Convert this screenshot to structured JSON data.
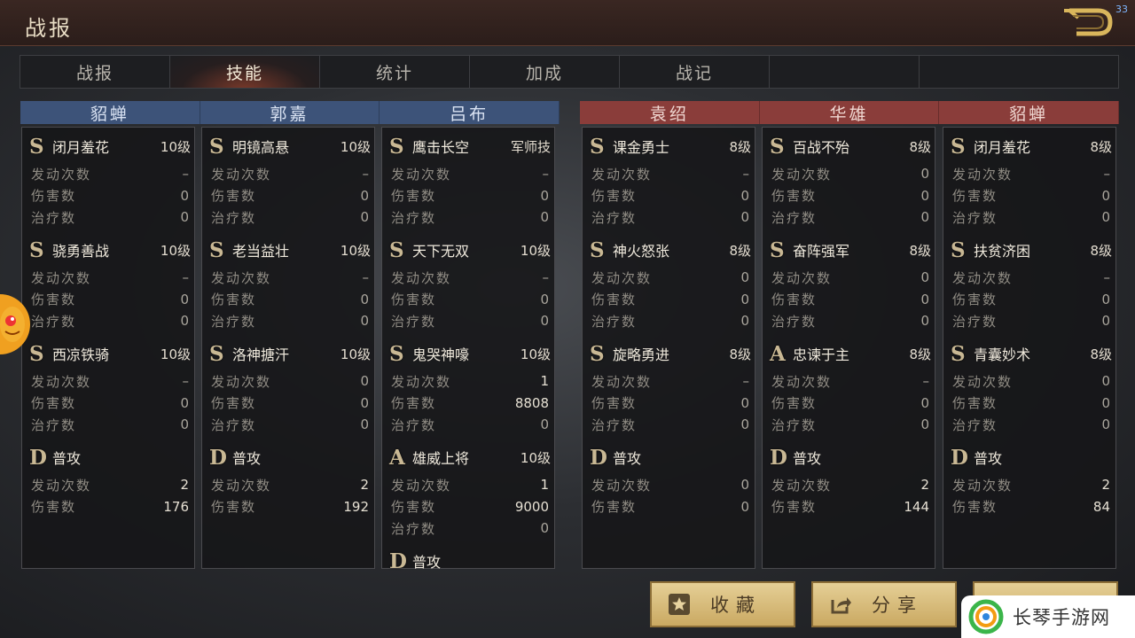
{
  "header": {
    "title": "战报",
    "corner_number": "33"
  },
  "tabs": [
    {
      "label": "战报",
      "active": false
    },
    {
      "label": "技能",
      "active": true
    },
    {
      "label": "统计",
      "active": false
    },
    {
      "label": "加成",
      "active": false
    },
    {
      "label": "战记",
      "active": false
    },
    {
      "label": "",
      "active": false
    },
    {
      "label": "",
      "active": false
    }
  ],
  "colors": {
    "ally": "#3d5379",
    "enemy": "#8a3d3a",
    "button": "#d8bd7c"
  },
  "columns": [
    {
      "general": "貂蝉",
      "side": "ally",
      "skills": [
        {
          "grade": "S",
          "name": "闭月羞花",
          "level": "10级",
          "stats": [
            {
              "label": "发动次数",
              "value": "–"
            },
            {
              "label": "伤害数",
              "value": "0"
            },
            {
              "label": "治疗数",
              "value": "0"
            }
          ]
        },
        {
          "grade": "S",
          "name": "骁勇善战",
          "level": "10级",
          "stats": [
            {
              "label": "发动次数",
              "value": "–"
            },
            {
              "label": "伤害数",
              "value": "0"
            },
            {
              "label": "治疗数",
              "value": "0"
            }
          ]
        },
        {
          "grade": "S",
          "name": "西凉铁骑",
          "level": "10级",
          "stats": [
            {
              "label": "发动次数",
              "value": "–"
            },
            {
              "label": "伤害数",
              "value": "0"
            },
            {
              "label": "治疗数",
              "value": "0"
            }
          ]
        },
        {
          "grade": "D",
          "name": "普攻",
          "level": "",
          "stats": [
            {
              "label": "发动次数",
              "value": "2"
            },
            {
              "label": "伤害数",
              "value": "176"
            }
          ]
        }
      ]
    },
    {
      "general": "郭嘉",
      "side": "ally",
      "skills": [
        {
          "grade": "S",
          "name": "明镜高悬",
          "level": "10级",
          "stats": [
            {
              "label": "发动次数",
              "value": "–"
            },
            {
              "label": "伤害数",
              "value": "0"
            },
            {
              "label": "治疗数",
              "value": "0"
            }
          ]
        },
        {
          "grade": "S",
          "name": "老当益壮",
          "level": "10级",
          "stats": [
            {
              "label": "发动次数",
              "value": "–"
            },
            {
              "label": "伤害数",
              "value": "0"
            },
            {
              "label": "治疗数",
              "value": "0"
            }
          ]
        },
        {
          "grade": "S",
          "name": "洛神搪汗",
          "level": "10级",
          "stats": [
            {
              "label": "发动次数",
              "value": "0"
            },
            {
              "label": "伤害数",
              "value": "0"
            },
            {
              "label": "治疗数",
              "value": "0"
            }
          ]
        },
        {
          "grade": "D",
          "name": "普攻",
          "level": "",
          "stats": [
            {
              "label": "发动次数",
              "value": "2"
            },
            {
              "label": "伤害数",
              "value": "192"
            }
          ]
        }
      ]
    },
    {
      "general": "吕布",
      "side": "ally",
      "skills": [
        {
          "grade": "S",
          "name": "鹰击长空",
          "level": "军师技",
          "stats": [
            {
              "label": "发动次数",
              "value": "–"
            },
            {
              "label": "伤害数",
              "value": "0"
            },
            {
              "label": "治疗数",
              "value": "0"
            }
          ]
        },
        {
          "grade": "S",
          "name": "天下无双",
          "level": "10级",
          "stats": [
            {
              "label": "发动次数",
              "value": "–"
            },
            {
              "label": "伤害数",
              "value": "0"
            },
            {
              "label": "治疗数",
              "value": "0"
            }
          ]
        },
        {
          "grade": "S",
          "name": "鬼哭神嚎",
          "level": "10级",
          "stats": [
            {
              "label": "发动次数",
              "value": "1"
            },
            {
              "label": "伤害数",
              "value": "8808"
            },
            {
              "label": "治疗数",
              "value": "0"
            }
          ]
        },
        {
          "grade": "A",
          "name": "雄威上将",
          "level": "10级",
          "stats": [
            {
              "label": "发动次数",
              "value": "1"
            },
            {
              "label": "伤害数",
              "value": "9000"
            },
            {
              "label": "治疗数",
              "value": "0"
            }
          ]
        },
        {
          "grade": "D",
          "name": "普攻",
          "level": "",
          "stats": []
        }
      ]
    },
    {
      "general": "袁绍",
      "side": "enemy",
      "skills": [
        {
          "grade": "S",
          "name": "课金勇士",
          "level": "8级",
          "stats": [
            {
              "label": "发动次数",
              "value": "–"
            },
            {
              "label": "伤害数",
              "value": "0"
            },
            {
              "label": "治疗数",
              "value": "0"
            }
          ]
        },
        {
          "grade": "S",
          "name": "神火怒张",
          "level": "8级",
          "stats": [
            {
              "label": "发动次数",
              "value": "0"
            },
            {
              "label": "伤害数",
              "value": "0"
            },
            {
              "label": "治疗数",
              "value": "0"
            }
          ]
        },
        {
          "grade": "S",
          "name": "旋略勇进",
          "level": "8级",
          "stats": [
            {
              "label": "发动次数",
              "value": "–"
            },
            {
              "label": "伤害数",
              "value": "0"
            },
            {
              "label": "治疗数",
              "value": "0"
            }
          ]
        },
        {
          "grade": "D",
          "name": "普攻",
          "level": "",
          "stats": [
            {
              "label": "发动次数",
              "value": "0"
            },
            {
              "label": "伤害数",
              "value": "0"
            }
          ]
        }
      ]
    },
    {
      "general": "华雄",
      "side": "enemy",
      "skills": [
        {
          "grade": "S",
          "name": "百战不殆",
          "level": "8级",
          "stats": [
            {
              "label": "发动次数",
              "value": "0"
            },
            {
              "label": "伤害数",
              "value": "0"
            },
            {
              "label": "治疗数",
              "value": "0"
            }
          ]
        },
        {
          "grade": "S",
          "name": "奋阵强军",
          "level": "8级",
          "stats": [
            {
              "label": "发动次数",
              "value": "0"
            },
            {
              "label": "伤害数",
              "value": "0"
            },
            {
              "label": "治疗数",
              "value": "0"
            }
          ]
        },
        {
          "grade": "A",
          "name": "忠谏于主",
          "level": "8级",
          "stats": [
            {
              "label": "发动次数",
              "value": "–"
            },
            {
              "label": "伤害数",
              "value": "0"
            },
            {
              "label": "治疗数",
              "value": "0"
            }
          ]
        },
        {
          "grade": "D",
          "name": "普攻",
          "level": "",
          "stats": [
            {
              "label": "发动次数",
              "value": "2"
            },
            {
              "label": "伤害数",
              "value": "144"
            }
          ]
        }
      ]
    },
    {
      "general": "貂蝉",
      "side": "enemy",
      "skills": [
        {
          "grade": "S",
          "name": "闭月羞花",
          "level": "8级",
          "stats": [
            {
              "label": "发动次数",
              "value": "–"
            },
            {
              "label": "伤害数",
              "value": "0"
            },
            {
              "label": "治疗数",
              "value": "0"
            }
          ]
        },
        {
          "grade": "S",
          "name": "扶贫济困",
          "level": "8级",
          "stats": [
            {
              "label": "发动次数",
              "value": "–"
            },
            {
              "label": "伤害数",
              "value": "0"
            },
            {
              "label": "治疗数",
              "value": "0"
            }
          ]
        },
        {
          "grade": "S",
          "name": "青囊妙术",
          "level": "8级",
          "stats": [
            {
              "label": "发动次数",
              "value": "0"
            },
            {
              "label": "伤害数",
              "value": "0"
            },
            {
              "label": "治疗数",
              "value": "0"
            }
          ]
        },
        {
          "grade": "D",
          "name": "普攻",
          "level": "",
          "stats": [
            {
              "label": "发动次数",
              "value": "2"
            },
            {
              "label": "伤害数",
              "value": "84"
            }
          ]
        }
      ]
    }
  ],
  "footer": {
    "favorite_label": "收藏",
    "share_label": "分享",
    "favorite_icon": "star-icon",
    "share_icon": "share-icon"
  },
  "watermark": {
    "text": "长琴手游网"
  }
}
